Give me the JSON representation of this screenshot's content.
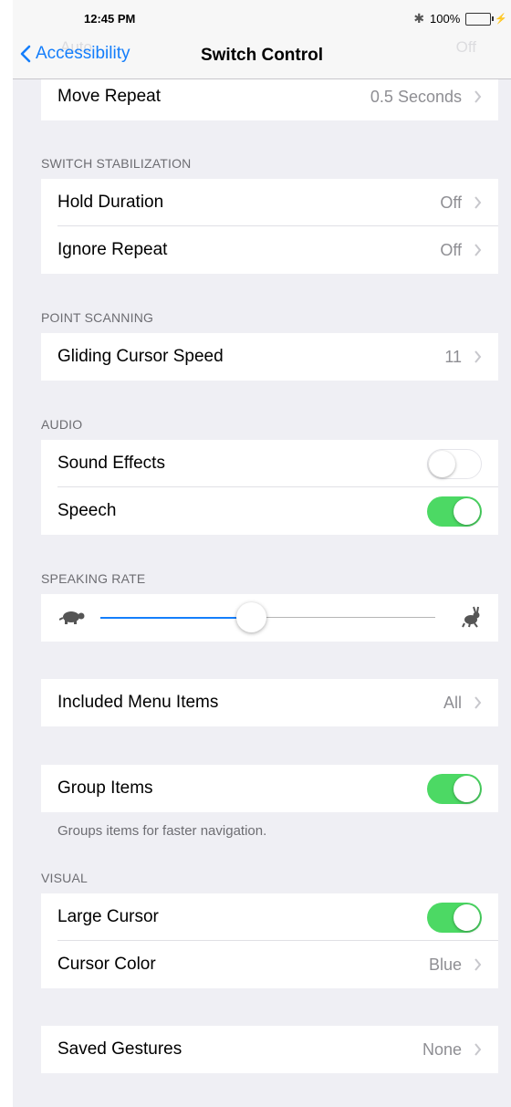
{
  "status": {
    "time": "12:45 PM",
    "battery": "100%"
  },
  "nav": {
    "back_label": "Accessibility",
    "title": "Switch Control",
    "ghost_left": "Auto",
    "ghost_right": "Off"
  },
  "rows": {
    "move_repeat": {
      "label": "Move Repeat",
      "value": "0.5 Seconds"
    },
    "hold_duration": {
      "label": "Hold Duration",
      "value": "Off"
    },
    "ignore_repeat": {
      "label": "Ignore Repeat",
      "value": "Off"
    },
    "gliding_cursor_speed": {
      "label": "Gliding Cursor Speed",
      "value": "11"
    },
    "sound_effects": {
      "label": "Sound Effects",
      "on": false
    },
    "speech": {
      "label": "Speech",
      "on": true
    },
    "included_menu_items": {
      "label": "Included Menu Items",
      "value": "All"
    },
    "group_items": {
      "label": "Group Items",
      "on": true
    },
    "large_cursor": {
      "label": "Large Cursor",
      "on": true
    },
    "cursor_color": {
      "label": "Cursor Color",
      "value": "Blue"
    },
    "saved_gestures": {
      "label": "Saved Gestures",
      "value": "None"
    }
  },
  "sections": {
    "switch_stabilization": "SWITCH STABILIZATION",
    "point_scanning": "POINT SCANNING",
    "audio": "AUDIO",
    "speaking_rate": "SPEAKING RATE",
    "visual": "VISUAL"
  },
  "notes": {
    "group_items_footer": "Groups items for faster navigation."
  },
  "speaking_rate": {
    "level": 0.45,
    "min_icon": "turtle-icon",
    "max_icon": "hare-icon"
  },
  "colors": {
    "accent": "#147efb",
    "toggle_on": "#4cd964",
    "background": "#efeff4",
    "secondary_text": "#8e8e93"
  }
}
